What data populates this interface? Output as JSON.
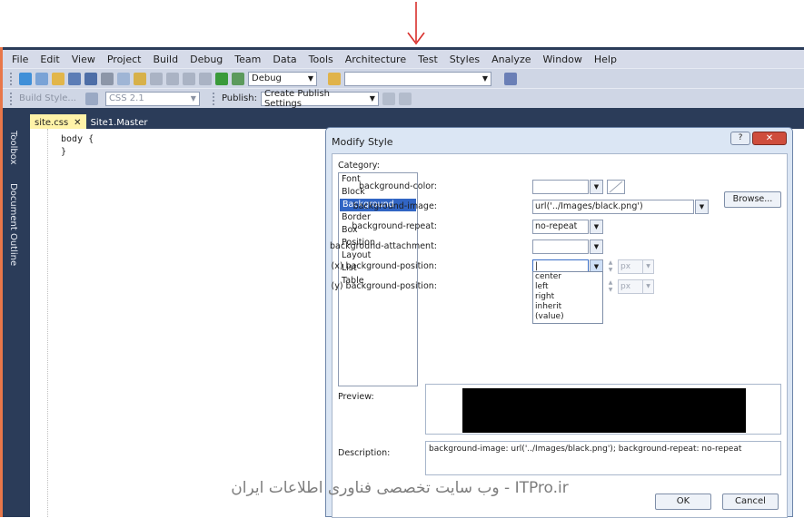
{
  "menu": [
    "File",
    "Edit",
    "View",
    "Project",
    "Build",
    "Debug",
    "Team",
    "Data",
    "Tools",
    "Architecture",
    "Test",
    "Styles",
    "Analyze",
    "Window",
    "Help"
  ],
  "toolbar1": {
    "config": "Debug"
  },
  "toolbar2": {
    "build_style": "Build Style...",
    "css_version": "CSS 2.1",
    "publish_label": "Publish:",
    "publish_value": "Create Publish Settings"
  },
  "tabs": {
    "active": "site.css",
    "inactive": "Site1.Master",
    "close_glyph": "✕"
  },
  "side_panels": {
    "toolbox": "Toolbox",
    "outline": "Document Outline"
  },
  "code": {
    "line1": "body {",
    "line2": "}"
  },
  "dialog": {
    "title": "Modify Style",
    "help": "?",
    "close": "✕",
    "category_label": "Category:",
    "categories": [
      "Font",
      "Block",
      "Background",
      "Border",
      "Box",
      "Position",
      "Layout",
      "List",
      "Table"
    ],
    "selected_category": "Background",
    "properties": {
      "bg_color_label": "background-color:",
      "bg_image_label": "background-image:",
      "bg_image_value": "url('../Images/black.png')",
      "bg_repeat_label": "background-repeat:",
      "bg_repeat_value": "no-repeat",
      "bg_attachment_label": "background-attachment:",
      "xpos_label": "(x) background-position:",
      "xpos_value": "|",
      "ypos_label": "(y) background-position:",
      "unit": "px",
      "browse": "Browse..."
    },
    "position_options": [
      "center",
      "left",
      "right",
      "inherit",
      "(value)"
    ],
    "preview_label": "Preview:",
    "description_label": "Description:",
    "description_text": "background-image: url('../Images/black.png'); background-repeat: no-repeat",
    "ok": "OK",
    "cancel": "Cancel"
  },
  "watermark": "ITPro.ir - وب سایت تخصصی فناوری اطلاعات ایران",
  "colors": {
    "accent_arrow": "#d9302c",
    "selection": "#3165c4",
    "ide_frame": "#2b3c59",
    "active_tab": "#fff3a8"
  }
}
